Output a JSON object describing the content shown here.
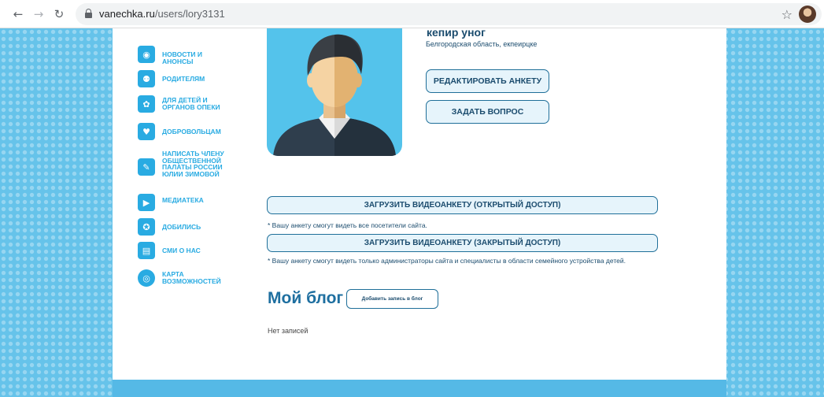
{
  "browser": {
    "url_host": "vanechka.ru",
    "url_path": "/users/lory3131",
    "back_icon": "←",
    "forward_icon": "→",
    "reload_icon": "↻",
    "star_icon": "☆"
  },
  "sidebar": {
    "items": [
      {
        "label": "НОВОСТИ И АНОНСЫ",
        "icon": "news-icon",
        "glyph": "◉"
      },
      {
        "label": "РОДИТЕЛЯМ",
        "icon": "parents-icon",
        "glyph": "⚉"
      },
      {
        "label": "ДЛЯ ДЕТЕЙ И ОРГАНОВ ОПЕКИ",
        "icon": "children-icon",
        "glyph": "✿"
      },
      {
        "label": "ДОБРОВОЛЬЦАМ",
        "icon": "heart-icon",
        "glyph": "♥"
      },
      {
        "label": "НАПИСАТЬ ЧЛЕНУ ОБЩЕСТВЕННОЙ ПАЛАТЫ РОССИИ ЮЛИИ ЗИМОВОЙ",
        "icon": "pen-icon",
        "glyph": "✎"
      },
      {
        "label": "МЕДИАТЕКА",
        "icon": "media-icon",
        "glyph": "▶"
      },
      {
        "label": "ДОБИЛИСЬ",
        "icon": "award-icon",
        "glyph": "✪"
      },
      {
        "label": "СМИ О НАС",
        "icon": "book-icon",
        "glyph": "▤"
      },
      {
        "label": "КАРТА ВОЗМОЖНОСТЕЙ",
        "icon": "map-pin-icon",
        "glyph": "◎"
      }
    ]
  },
  "profile": {
    "name": "кепир уног",
    "region": "Белгородская область, екпеирцке",
    "edit_button": "РЕДАКТИРОВАТЬ АНКЕТУ",
    "ask_button": "ЗАДАТЬ ВОПРОС"
  },
  "video": {
    "open_button": "ЗАГРУЗИТЬ ВИДЕОАНКЕТУ (ОТКРЫТЫЙ ДОСТУП)",
    "open_note": "* Вашу анкету смогут видеть все посетители сайта.",
    "closed_button": "ЗАГРУЗИТЬ ВИДЕОАНКЕТУ (ЗАКРЫТЫЙ ДОСТУП)",
    "closed_note": "* Вашу анкету смогут видеть только администраторы сайта и специалисты в области семейного устройства детей."
  },
  "blog": {
    "title": "Мой блог",
    "add_button": "Добавить запись в блог",
    "empty_text": "Нет записей"
  },
  "colors": {
    "page_bg": "#66c3ea",
    "accent": "#29abe2",
    "text_dark": "#1b4c6e"
  }
}
